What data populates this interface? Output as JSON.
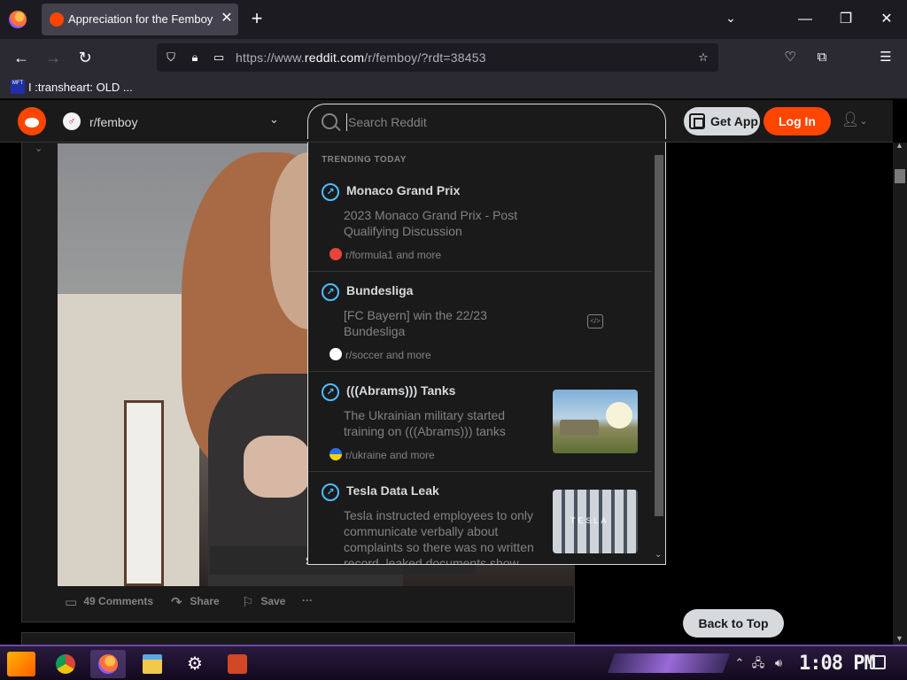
{
  "browser": {
    "tab_title": "Appreciation for the Femboy",
    "tab_close": "✕",
    "new_tab": "+",
    "list_tabs": "⌄",
    "window": {
      "minimize": "—",
      "restore": "❐",
      "close": "✕"
    },
    "url_prefix": "https://www.",
    "url_domain": "reddit.com",
    "url_path": "/r/femboy/?rdt=38453",
    "bookmark": {
      "icon_text": "MFT",
      "label": "I :transheart: OLD ..."
    }
  },
  "reddit": {
    "subreddit_icon": "♂",
    "subreddit": "r/femboy",
    "search_placeholder": "Search Reddit",
    "get_app": "Get App",
    "login": "Log In",
    "post": {
      "see_full": "SEE FU",
      "comments": "49 Comments",
      "share": "Share",
      "save": "Save",
      "more": "···"
    },
    "back_to_top": "Back to Top",
    "dropdown": {
      "heading": "TRENDING TODAY",
      "items": [
        {
          "title": "Monaco Grand Prix",
          "description": "2023 Monaco Grand Prix - Post Qualifying Discussion",
          "source": "r/formula1 and more",
          "icon_color": "#e8443a"
        },
        {
          "title": "Bundesliga",
          "description": "[FC Bayern] win the 22/23 Bundesliga",
          "source": "r/soccer and more",
          "icon_color": "#ffffff"
        },
        {
          "title": "(((Abrams))) Tanks",
          "description": "The Ukrainian military started training on (((Abrams))) tanks",
          "source": "r/ukraine and more",
          "icon_color": "#f5d30a"
        },
        {
          "title": "Tesla Data Leak",
          "description": "Tesla instructed employees to only communicate verbally about complaints so there was no written record, leaked documents show",
          "source": "",
          "icon_color": "#ff4500"
        }
      ]
    }
  },
  "taskbar": {
    "clock": "1:08 PM",
    "apps": [
      "chrome-icon",
      "firefox-icon",
      "file-explorer-icon",
      "settings-icon",
      "powerpoint-icon"
    ]
  },
  "colors": {
    "reddit_orange": "#ff4500",
    "trend_blue": "#4fbcff",
    "surface": "#1a1a1b"
  }
}
